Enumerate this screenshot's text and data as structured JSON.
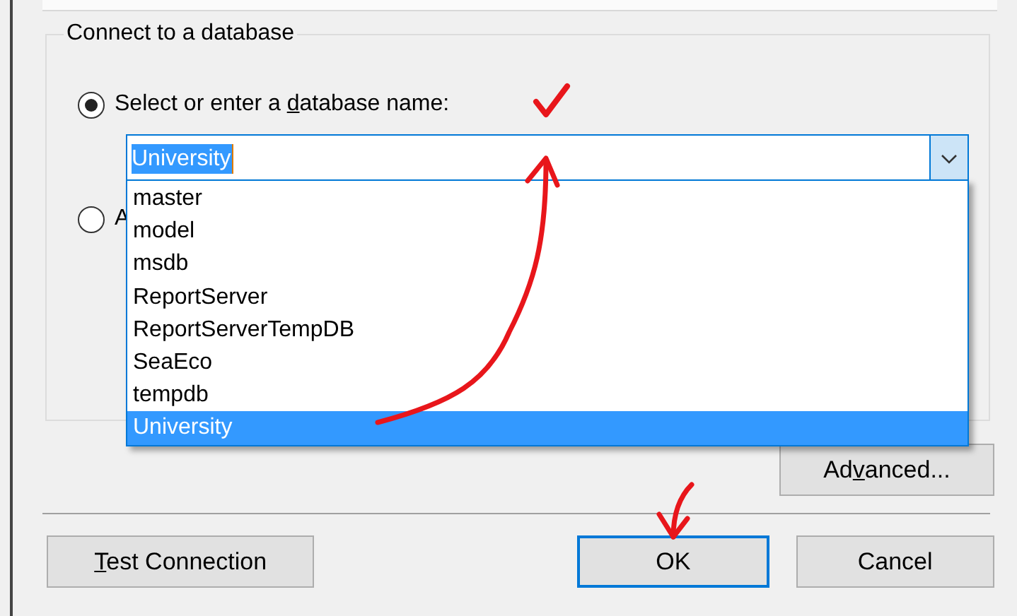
{
  "group": {
    "title": "Connect to a database"
  },
  "options": [
    {
      "label_before": "Select or enter a ",
      "access_key": "d",
      "label_after": "atabase name:",
      "selected": true
    },
    {
      "label": "A",
      "selected": false
    }
  ],
  "database_combo": {
    "value": "University",
    "text_selected": true,
    "expanded": true,
    "items": [
      {
        "label": "master",
        "selected": false
      },
      {
        "label": "model",
        "selected": false
      },
      {
        "label": "msdb",
        "selected": false
      },
      {
        "label": "ReportServer",
        "selected": false
      },
      {
        "label": "ReportServerTempDB",
        "selected": false
      },
      {
        "label": "SeaEco",
        "selected": false
      },
      {
        "label": "tempdb",
        "selected": false
      },
      {
        "label": "University",
        "selected": true
      }
    ]
  },
  "advanced_button": {
    "label_before": "Ad",
    "access_key": "v",
    "label_after": "anced..."
  },
  "buttons": [
    {
      "access_key": "T",
      "label_after": "est Connection",
      "default": false
    },
    {
      "label": "OK",
      "default": true
    },
    {
      "label": "Cancel",
      "default": false
    }
  ]
}
